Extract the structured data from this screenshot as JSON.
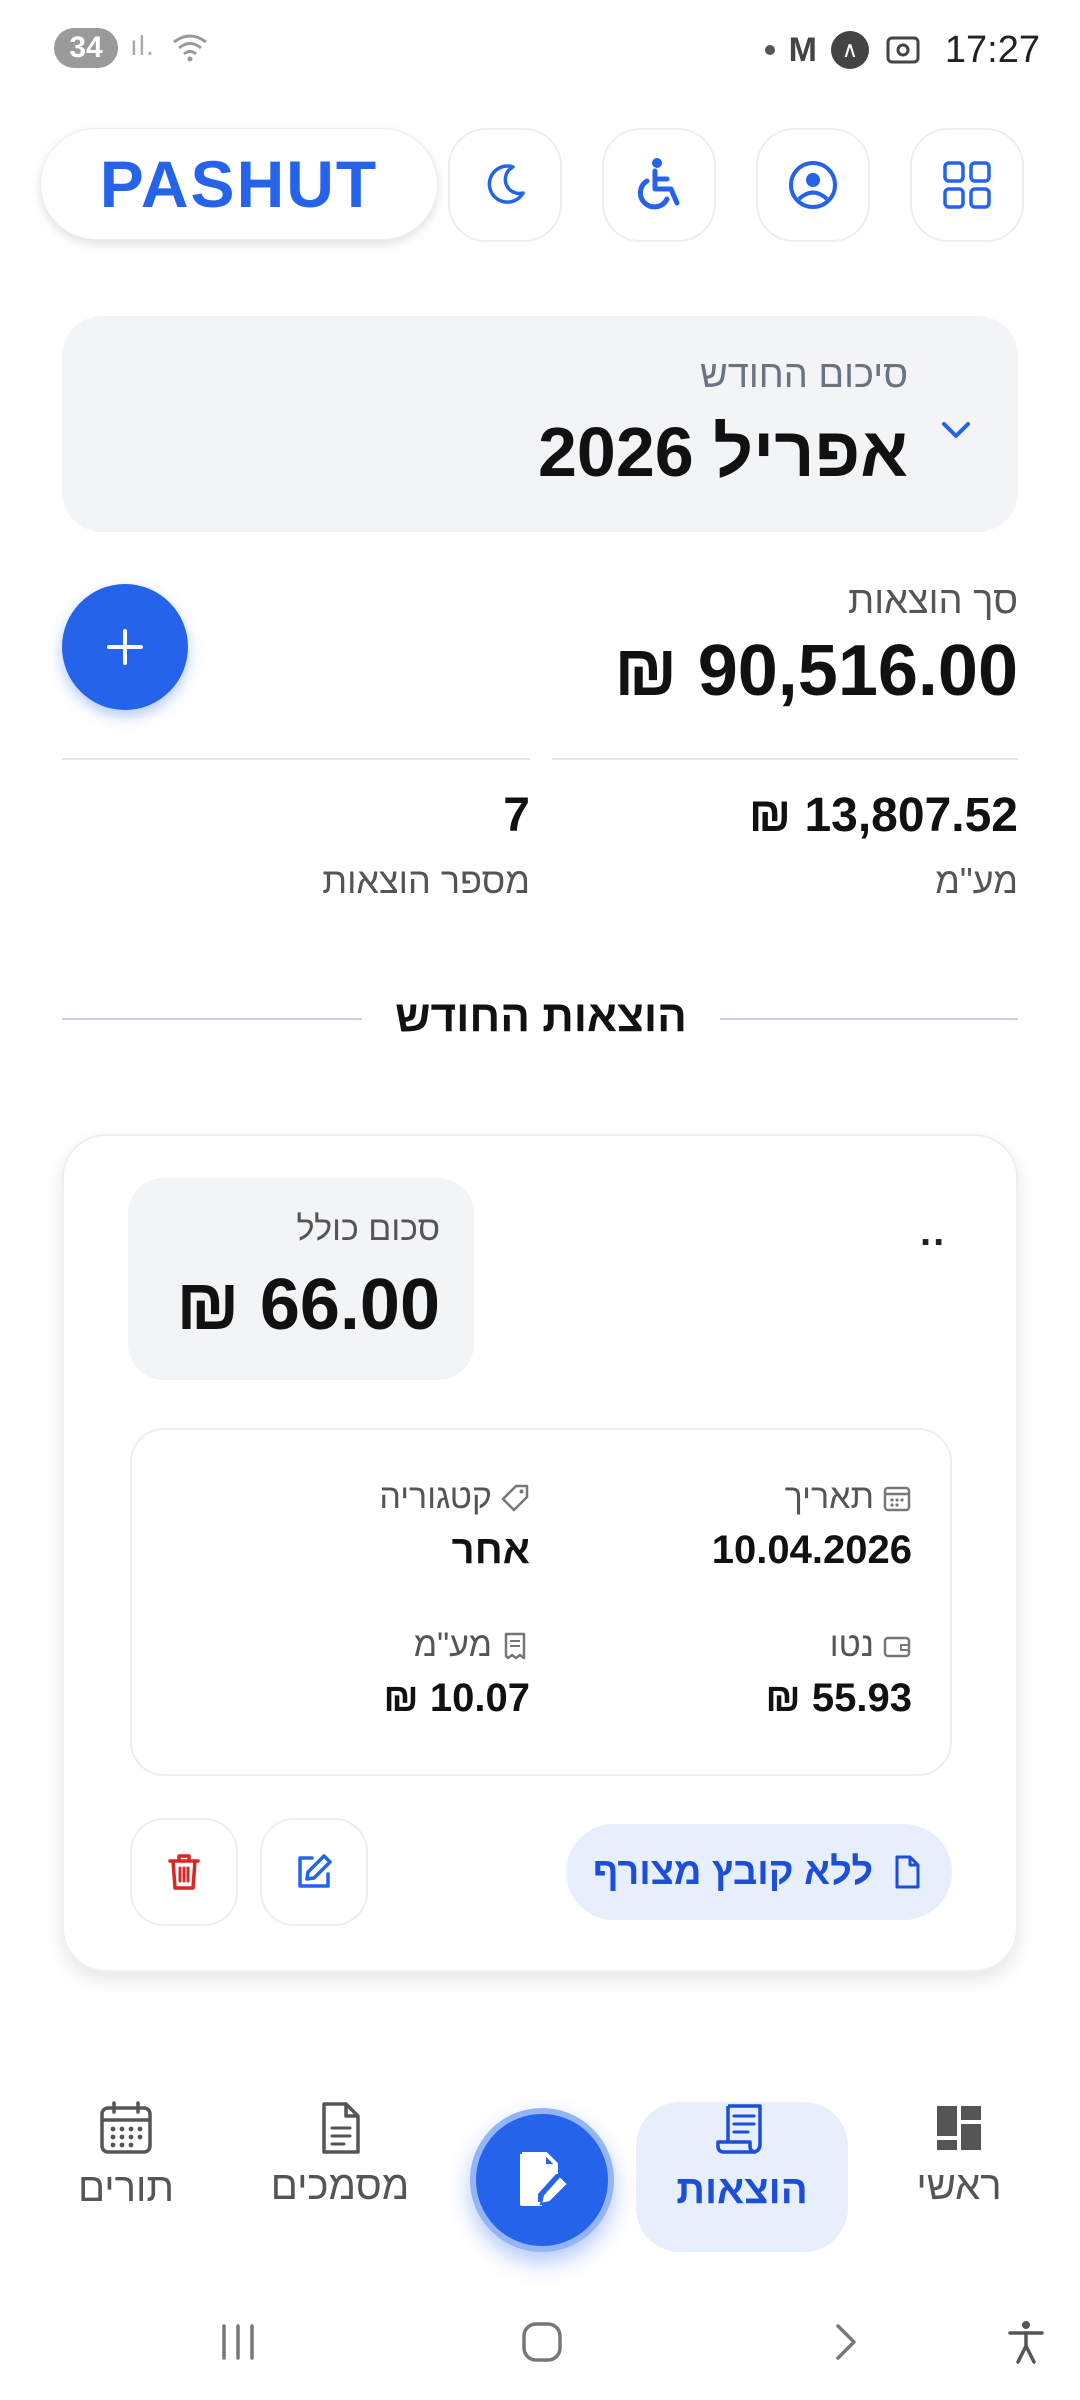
{
  "status_bar": {
    "notification_count": "34",
    "time": "17:27"
  },
  "header": {
    "logo": "PASHUT",
    "buttons": [
      "dark-mode",
      "accessibility",
      "profile",
      "apps"
    ]
  },
  "summary": {
    "subtitle": "סיכום החודש",
    "month": "אפריל 2026"
  },
  "totals": {
    "total_label": "סך הוצאות",
    "total_value": "90,516.00 ₪",
    "vat_value": "13,807.52 ₪",
    "vat_label": "מע\"מ",
    "count_value": "7",
    "count_label": "מספר הוצאות"
  },
  "section": {
    "title": "הוצאות החודש"
  },
  "expense": {
    "sum_label": "סכום כולל",
    "sum_value": "66.00 ₪",
    "date_label": "תאריך",
    "date_value": "10.04.2026",
    "category_label": "קטגוריה",
    "category_value": "אחר",
    "net_label": "נטו",
    "net_value": "55.93 ₪",
    "vat_label": "מע\"מ",
    "vat_value": "10.07 ₪",
    "attachment_label": "ללא קובץ מצורף",
    "more_label": ".."
  },
  "bottom_nav": {
    "home": "ראשי",
    "expenses": "הוצאות",
    "documents": "מסמכים",
    "appointments": "תורים",
    "active": "expenses"
  },
  "colors": {
    "accent": "#2563eb",
    "accent_light": "#e8effc",
    "danger": "#dc2626"
  }
}
